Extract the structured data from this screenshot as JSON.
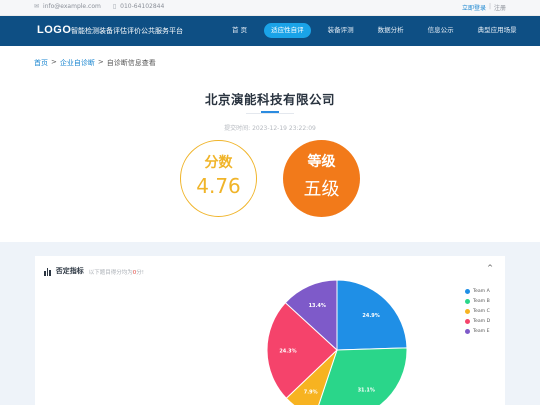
{
  "topbar": {
    "email": "info@example.com",
    "phone": "010-64102844",
    "login": "立即登录",
    "divider": "|",
    "register": "注册",
    "mail_icon": "mail-icon",
    "phone_icon": "phone-icon"
  },
  "nav": {
    "logo": "LOGO",
    "site_name": "智能检测装备评估评价公共服务平台",
    "items": [
      "首 页",
      "适应性自评",
      "装备评测",
      "数据分析",
      "信息公示",
      "典型应用场景"
    ],
    "active_index": 1
  },
  "breadcrumb": {
    "home": "首页",
    "sep1": ">",
    "section": "企业自诊断",
    "sep2": ">",
    "current": "自诊断信息查看"
  },
  "report": {
    "company": "北京演能科技有限公司",
    "submitted": "提交时间: 2023-12-19 23:22:09",
    "score_label": "分数",
    "score_value": "4.76",
    "grade_label": "等级",
    "grade_value": "五级"
  },
  "panel": {
    "icon": "bar-chart-icon",
    "title": "否定指标",
    "hint_prefix": "以下题目得分均为",
    "hint_value": "0",
    "hint_suffix": "分!",
    "collapse_icon": "chevron-up-icon",
    "collapse_glyph": "^"
  },
  "chart_data": {
    "type": "pie",
    "series": [
      {
        "name": "Team A",
        "value": 24.9,
        "label": "24.9%",
        "color": "#1f8fe6"
      },
      {
        "name": "Team B",
        "value": 31.1,
        "label": "31.1%",
        "color": "#2ad68a"
      },
      {
        "name": "Team C",
        "value": 7.9,
        "label": "7.9%",
        "color": "#f7b321"
      },
      {
        "name": "Team D",
        "value": 24.3,
        "label": "24.3%",
        "color": "#f5436b"
      },
      {
        "name": "Team E",
        "value": 13.4,
        "label": "13.4%",
        "color": "#7e5ac9"
      }
    ],
    "legend_position": "top-right"
  }
}
